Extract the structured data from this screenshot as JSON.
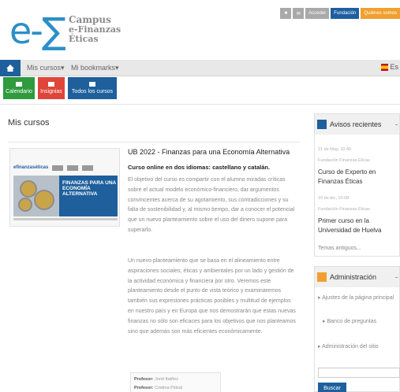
{
  "header": {
    "logo_prefix": "e-∑",
    "logo_line1": "Campus",
    "logo_line2": "e-Finanzas",
    "logo_line3": "Éticas",
    "top_buttons": [
      "Acceder",
      "Fundación",
      "Quiénes somos"
    ]
  },
  "nav": {
    "mis_cursos": "Mis cursos",
    "bookmarks": "Mi bookmarks",
    "lang": "Es"
  },
  "quick": [
    "Calendario",
    "Insignias",
    "Todos los cursos"
  ],
  "main": {
    "title": "Mis cursos",
    "course": {
      "title": "UB 2022 - Finanzas para una Economía Alternativa",
      "subtitle": "Curso online en dos idiomas: castellano y catalán.",
      "p1": "El objetivo del curso es compartir con el alumno miradas críticas sobre el actual modelo económico-financiero, dar argumentos convincentes acerca de su agotamiento, sus contradicciones y su falta de sostenibilidad y, al mismo tiempo, dar a conocer el potencial que un nuevo planteamiento sobre el uso del dinero supone para superarlo.",
      "p2": "Un nuevo planteamiento que se basa en el alineamiento entre aspiraciones sociales, éticas y ambientales por un lado y gestión de la actividad económica y financiera por otro. Veremos este planteamiento desde el punto de vista teórico y examinaremos también sus expresiones prácticas posibles y multitud de ejemplos en nuestro país y en Europa que nos demostrarán que estas nuevas finanzas no sólo son eficaces para los objetivos que nos planteamos sino que además son más eficientes económicamente.",
      "thumb_brand": "efinanzaséticas",
      "thumb_title": "FINANZAS PARA UNA ECONOMÍA ALTERNATIVA",
      "teachers": [
        {
          "role": "Profesor:",
          "name": "Jordi Ibáñez"
        },
        {
          "role": "Profesor:",
          "name": "Cristina Pidzal"
        }
      ]
    }
  },
  "sidebar": {
    "avisos": {
      "title": "Avisos recientes",
      "items": [
        {
          "date": "21 de May, 10:40",
          "author": "Fundación Finanzas Éticas",
          "text": "Curso de Experto en Finanzas Éticas"
        },
        {
          "date": "10 de dic, 10:08",
          "author": "Fundación Finanzas Éticas",
          "text": "Primer curso en la Universidad de Huelva"
        }
      ],
      "older": "Temas antiguos..."
    },
    "admin": {
      "title": "Administración",
      "item1": "Ajustes de la página principal",
      "item2": "Banco de preguntas",
      "item3": "Administración del sitio",
      "search_button": "Buscar"
    }
  },
  "colors": {
    "brand_blue": "#1e5f9c",
    "accent_orange": "#f0a030",
    "green": "#2e9b3e",
    "red": "#e0453a"
  }
}
